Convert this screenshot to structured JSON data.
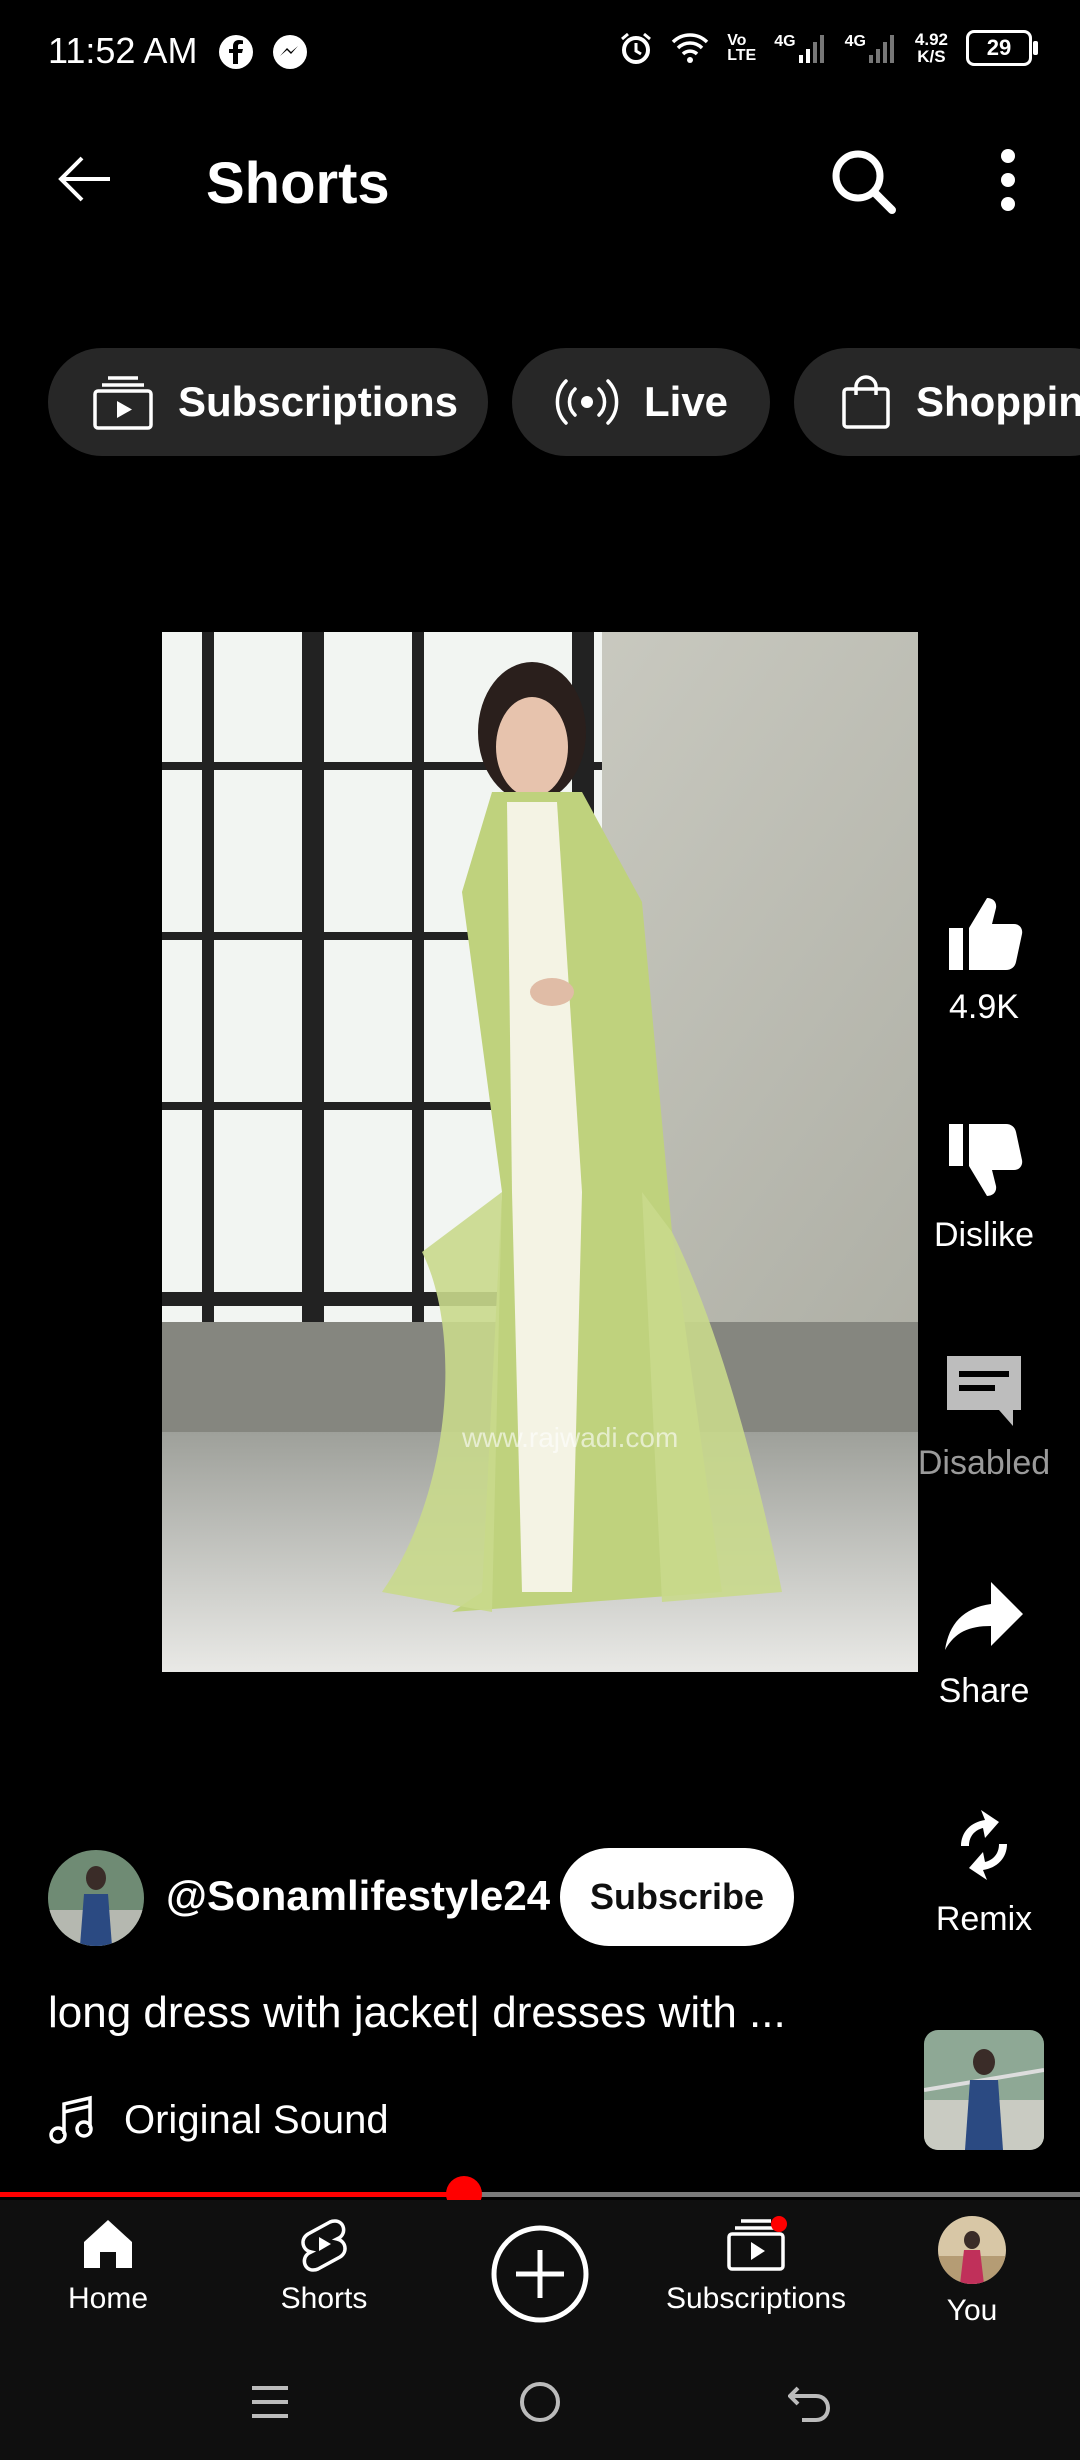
{
  "status_bar": {
    "time": "11:52 AM",
    "net_speed_value": "4.92",
    "net_speed_unit": "K/S",
    "battery": "29",
    "vo_top": "Vo",
    "vo_bottom": "LTE",
    "signal_1": "4G",
    "signal_2": "4G"
  },
  "header": {
    "title": "Shorts"
  },
  "chips": [
    {
      "label": "Subscriptions"
    },
    {
      "label": "Live"
    },
    {
      "label": "Shopping"
    }
  ],
  "video": {
    "watermark": "www.rajwadi.com"
  },
  "actions": {
    "like_count": "4.9K",
    "dislike_label": "Dislike",
    "comments_label": "Disabled",
    "share_label": "Share",
    "remix_label": "Remix"
  },
  "channel": {
    "handle": "@Sonamlifestyle24",
    "subscribe_label": "Subscribe"
  },
  "caption": "long dress with jacket| dresses with  ...",
  "sound": {
    "label": "Original Sound"
  },
  "progress": {
    "fraction": 0.43
  },
  "bottom_nav": [
    {
      "label": "Home"
    },
    {
      "label": "Shorts"
    },
    {
      "label": ""
    },
    {
      "label": "Subscriptions"
    },
    {
      "label": "You"
    }
  ],
  "colors": {
    "accent": "#ff0000",
    "chip_bg": "#272727",
    "background": "#000000"
  }
}
